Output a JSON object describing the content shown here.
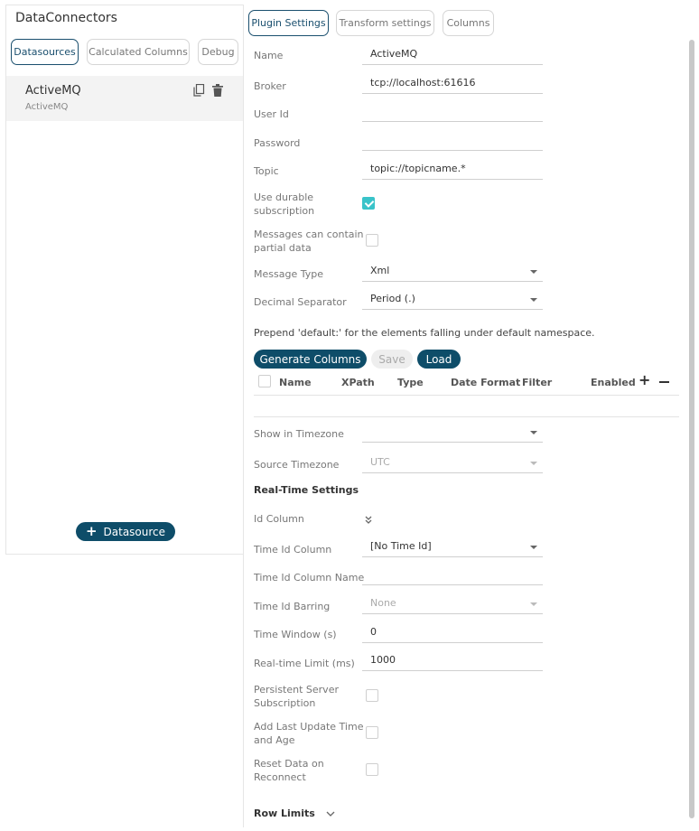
{
  "app": {
    "title": "DataConnectors"
  },
  "left_tabs": [
    {
      "label": "Datasources",
      "active": true
    },
    {
      "label": "Calculated Columns",
      "active": false
    },
    {
      "label": "Debug",
      "active": false
    }
  ],
  "datasource_item": {
    "name": "ActiveMQ",
    "subtitle": "ActiveMQ",
    "icons": [
      "copy-icon",
      "trash-icon"
    ]
  },
  "add_datasource": {
    "label": "Datasource",
    "icon": "plus-icon"
  },
  "right_tabs": [
    {
      "label": "Plugin Settings",
      "active": true
    },
    {
      "label": "Transform settings",
      "active": false
    },
    {
      "label": "Columns",
      "active": false
    }
  ],
  "settings": {
    "name": {
      "label": "Name",
      "value": "ActiveMQ"
    },
    "broker": {
      "label": "Broker",
      "value": "tcp://localhost:61616"
    },
    "user_id": {
      "label": "User Id",
      "value": ""
    },
    "password": {
      "label": "Password",
      "value": ""
    },
    "topic": {
      "label": "Topic",
      "value": "topic://topicname.*"
    },
    "durable": {
      "label_line1": "Use durable",
      "label_line2": "subscription",
      "checked": true
    },
    "partial": {
      "label_line1": "Messages can contain",
      "label_line2": "partial data",
      "checked": false
    },
    "message_type": {
      "label": "Message Type",
      "value": "Xml"
    },
    "decimal_separator": {
      "label": "Decimal Separator",
      "value": "Period (.)"
    }
  },
  "namespace_note": "Prepend 'default:' for the elements falling under default namespace.",
  "column_buttons": {
    "generate": "Generate Columns",
    "save": "Save",
    "load": "Load"
  },
  "column_table": {
    "headers": [
      "Name",
      "XPath",
      "Type",
      "Date Format",
      "Filter",
      "Enabled"
    ],
    "add_icon": "plus-icon",
    "remove_icon": "minus-icon"
  },
  "timezone": {
    "show": {
      "label": "Show in Timezone",
      "value": ""
    },
    "source": {
      "label": "Source Timezone",
      "value": "UTC"
    }
  },
  "realtime": {
    "title": "Real-Time Settings",
    "id_column": {
      "label": "Id Column",
      "icon": "double-chevron-down-icon"
    },
    "time_id_column": {
      "label": "Time Id Column",
      "value": "[No Time Id]"
    },
    "time_id_column_name": {
      "label": "Time Id Column Name",
      "value": ""
    },
    "time_id_barring": {
      "label": "Time Id Barring",
      "value": "None"
    },
    "time_window": {
      "label": "Time Window (s)",
      "value": "0"
    },
    "realtime_limit": {
      "label": "Real-time Limit (ms)",
      "value": "1000"
    },
    "persistent": {
      "label_line1": "Persistent Server",
      "label_line2": "Subscription",
      "checked": false
    },
    "last_update": {
      "label_line1": "Add Last Update Time",
      "label_line2": "and Age",
      "checked": false
    },
    "reset": {
      "label_line1": "Reset Data on",
      "label_line2": "Reconnect",
      "checked": false
    }
  },
  "row_limits": {
    "label": "Row Limits",
    "icon": "chevron-down-icon"
  },
  "colors": {
    "accent": "#0e4d69",
    "check": "#39c3c9",
    "border": "#d6d6d6"
  }
}
